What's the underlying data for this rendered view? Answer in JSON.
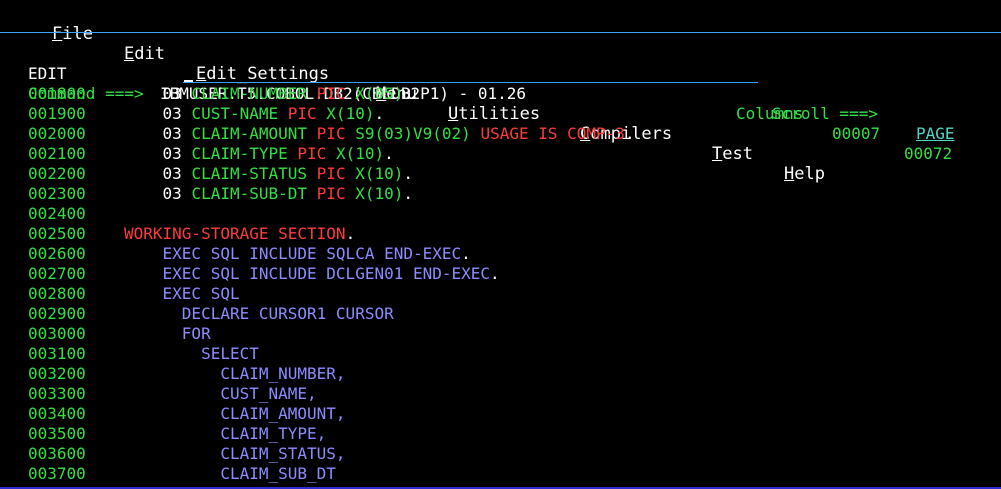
{
  "menu": [
    {
      "mnemonic": "F",
      "rest": "ile"
    },
    {
      "mnemonic": "E",
      "rest": "dit"
    },
    {
      "mnemonic": "E",
      "rest": "dit_Settings"
    },
    {
      "mnemonic": "M",
      "rest": "enu"
    },
    {
      "mnemonic": "U",
      "rest": "tilities"
    },
    {
      "mnemonic": "C",
      "rest": "ompilers"
    },
    {
      "mnemonic": "T",
      "rest": "est"
    },
    {
      "mnemonic": "H",
      "rest": "elp"
    }
  ],
  "header": {
    "mode": "EDIT",
    "dataset": "IBMUSER.T5.COBOL.DB2(CBLDB2P1) - 01.26",
    "columns_label": "Columns",
    "col_from": "00007",
    "col_to": "00072"
  },
  "command": {
    "label": "Command ===>",
    "value": "",
    "scroll_label": "Scroll ===>",
    "scroll_value": "PAGE"
  },
  "lines": [
    {
      "num": "001800",
      "indent": "    ",
      "segs": [
        [
          "white",
          "03 "
        ],
        [
          "green",
          "CLAIM-NUMBER "
        ],
        [
          "red",
          "PIC "
        ],
        [
          "green",
          "X(05)"
        ],
        [
          "white",
          "."
        ]
      ]
    },
    {
      "num": "001900",
      "indent": "    ",
      "segs": [
        [
          "white",
          "03 "
        ],
        [
          "green",
          "CUST-NAME "
        ],
        [
          "red",
          "PIC "
        ],
        [
          "green",
          "X(10)"
        ],
        [
          "white",
          "."
        ]
      ]
    },
    {
      "num": "002000",
      "indent": "    ",
      "segs": [
        [
          "white",
          "03 "
        ],
        [
          "green",
          "CLAIM-AMOUNT "
        ],
        [
          "red",
          "PIC "
        ],
        [
          "green",
          "S9(03)V9(02) "
        ],
        [
          "red",
          "USAGE IS COMP-3"
        ],
        [
          "white",
          "."
        ]
      ]
    },
    {
      "num": "002100",
      "indent": "    ",
      "segs": [
        [
          "white",
          "03 "
        ],
        [
          "green",
          "CLAIM-TYPE "
        ],
        [
          "red",
          "PIC "
        ],
        [
          "green",
          "X(10)"
        ],
        [
          "white",
          "."
        ]
      ]
    },
    {
      "num": "002200",
      "indent": "    ",
      "segs": [
        [
          "white",
          "03 "
        ],
        [
          "green",
          "CLAIM-STATUS "
        ],
        [
          "red",
          "PIC "
        ],
        [
          "green",
          "X(10)"
        ],
        [
          "white",
          "."
        ]
      ]
    },
    {
      "num": "002300",
      "indent": "    ",
      "segs": [
        [
          "white",
          "03 "
        ],
        [
          "green",
          "CLAIM-SUB-DT "
        ],
        [
          "red",
          "PIC "
        ],
        [
          "green",
          "X(10)"
        ],
        [
          "white",
          "."
        ]
      ]
    },
    {
      "num": "002400",
      "indent": "",
      "segs": []
    },
    {
      "num": "002500",
      "indent": "",
      "segs": [
        [
          "red",
          "WORKING-STORAGE SECTION"
        ],
        [
          "white",
          "."
        ]
      ]
    },
    {
      "num": "002600",
      "indent": "    ",
      "segs": [
        [
          "blue",
          "EXEC SQL INCLUDE SQLCA END-EXEC"
        ],
        [
          "white",
          "."
        ]
      ]
    },
    {
      "num": "002700",
      "indent": "    ",
      "segs": [
        [
          "blue",
          "EXEC SQL INCLUDE DCLGEN01 END-EXEC"
        ],
        [
          "white",
          "."
        ]
      ]
    },
    {
      "num": "002800",
      "indent": "    ",
      "segs": [
        [
          "blue",
          "EXEC SQL"
        ]
      ]
    },
    {
      "num": "002900",
      "indent": "      ",
      "segs": [
        [
          "blue",
          "DECLARE CURSOR1 CURSOR"
        ]
      ]
    },
    {
      "num": "003000",
      "indent": "      ",
      "segs": [
        [
          "blue",
          "FOR"
        ]
      ]
    },
    {
      "num": "003100",
      "indent": "        ",
      "segs": [
        [
          "blue",
          "SELECT"
        ]
      ]
    },
    {
      "num": "003200",
      "indent": "          ",
      "segs": [
        [
          "blue",
          "CLAIM_NUMBER,"
        ]
      ]
    },
    {
      "num": "003300",
      "indent": "          ",
      "segs": [
        [
          "blue",
          "CUST_NAME,"
        ]
      ]
    },
    {
      "num": "003400",
      "indent": "          ",
      "segs": [
        [
          "blue",
          "CLAIM_AMOUNT,"
        ]
      ]
    },
    {
      "num": "003500",
      "indent": "          ",
      "segs": [
        [
          "blue",
          "CLAIM_TYPE,"
        ]
      ]
    },
    {
      "num": "003600",
      "indent": "          ",
      "segs": [
        [
          "blue",
          "CLAIM_STATUS,"
        ]
      ]
    },
    {
      "num": "003700",
      "indent": "          ",
      "segs": [
        [
          "blue",
          "CLAIM_SUB_DT"
        ]
      ]
    }
  ]
}
